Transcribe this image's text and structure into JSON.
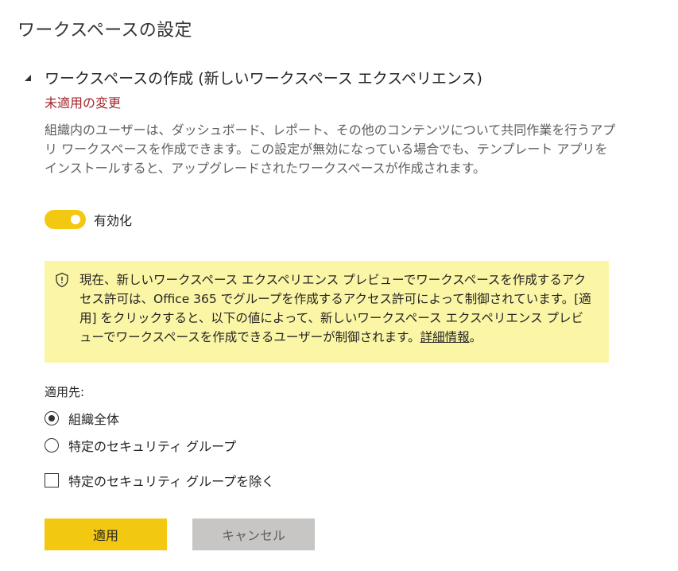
{
  "page": {
    "title": "ワークスペースの設定"
  },
  "section": {
    "title": "ワークスペースの作成 (新しいワークスペース エクスペリエンス)",
    "collapse_icon": "triangle-down-icon",
    "status": "未適用の変更",
    "description": "組織内のユーザーは、ダッシュボード、レポート、その他のコンテンツについて共同作業を行うアプリ ワークスペースを作成できます。この設定が無効になっている場合でも、テンプレート アプリをインストールすると、アップグレードされたワークスペースが作成されます。"
  },
  "toggle": {
    "state": "on",
    "label": "有効化"
  },
  "warning": {
    "icon": "shield-warning-icon",
    "text": "現在、新しいワークスペース エクスペリエンス プレビューでワークスペースを作成するアクセス許可は、Office 365 でグループを作成するアクセス許可によって制御されています。[適用] をクリックすると、以下の値によって、新しいワークスペース エクスペリエンス プレビューでワークスペースを作成できるユーザーが制御されます。",
    "link_text": "詳細情報",
    "trailing": "。"
  },
  "apply_to": {
    "label": "適用先:",
    "options": [
      {
        "label": "組織全体",
        "selected": true
      },
      {
        "label": "特定のセキュリティ グループ",
        "selected": false
      }
    ]
  },
  "exclude": {
    "label": "特定のセキュリティ グループを除く",
    "checked": false
  },
  "buttons": {
    "apply": "適用",
    "cancel": "キャンセル"
  },
  "colors": {
    "accent": "#f2c811",
    "warning_background": "#fbf6a6",
    "unapplied_text": "#a4262c",
    "cancel_background": "#c8c6c4"
  }
}
